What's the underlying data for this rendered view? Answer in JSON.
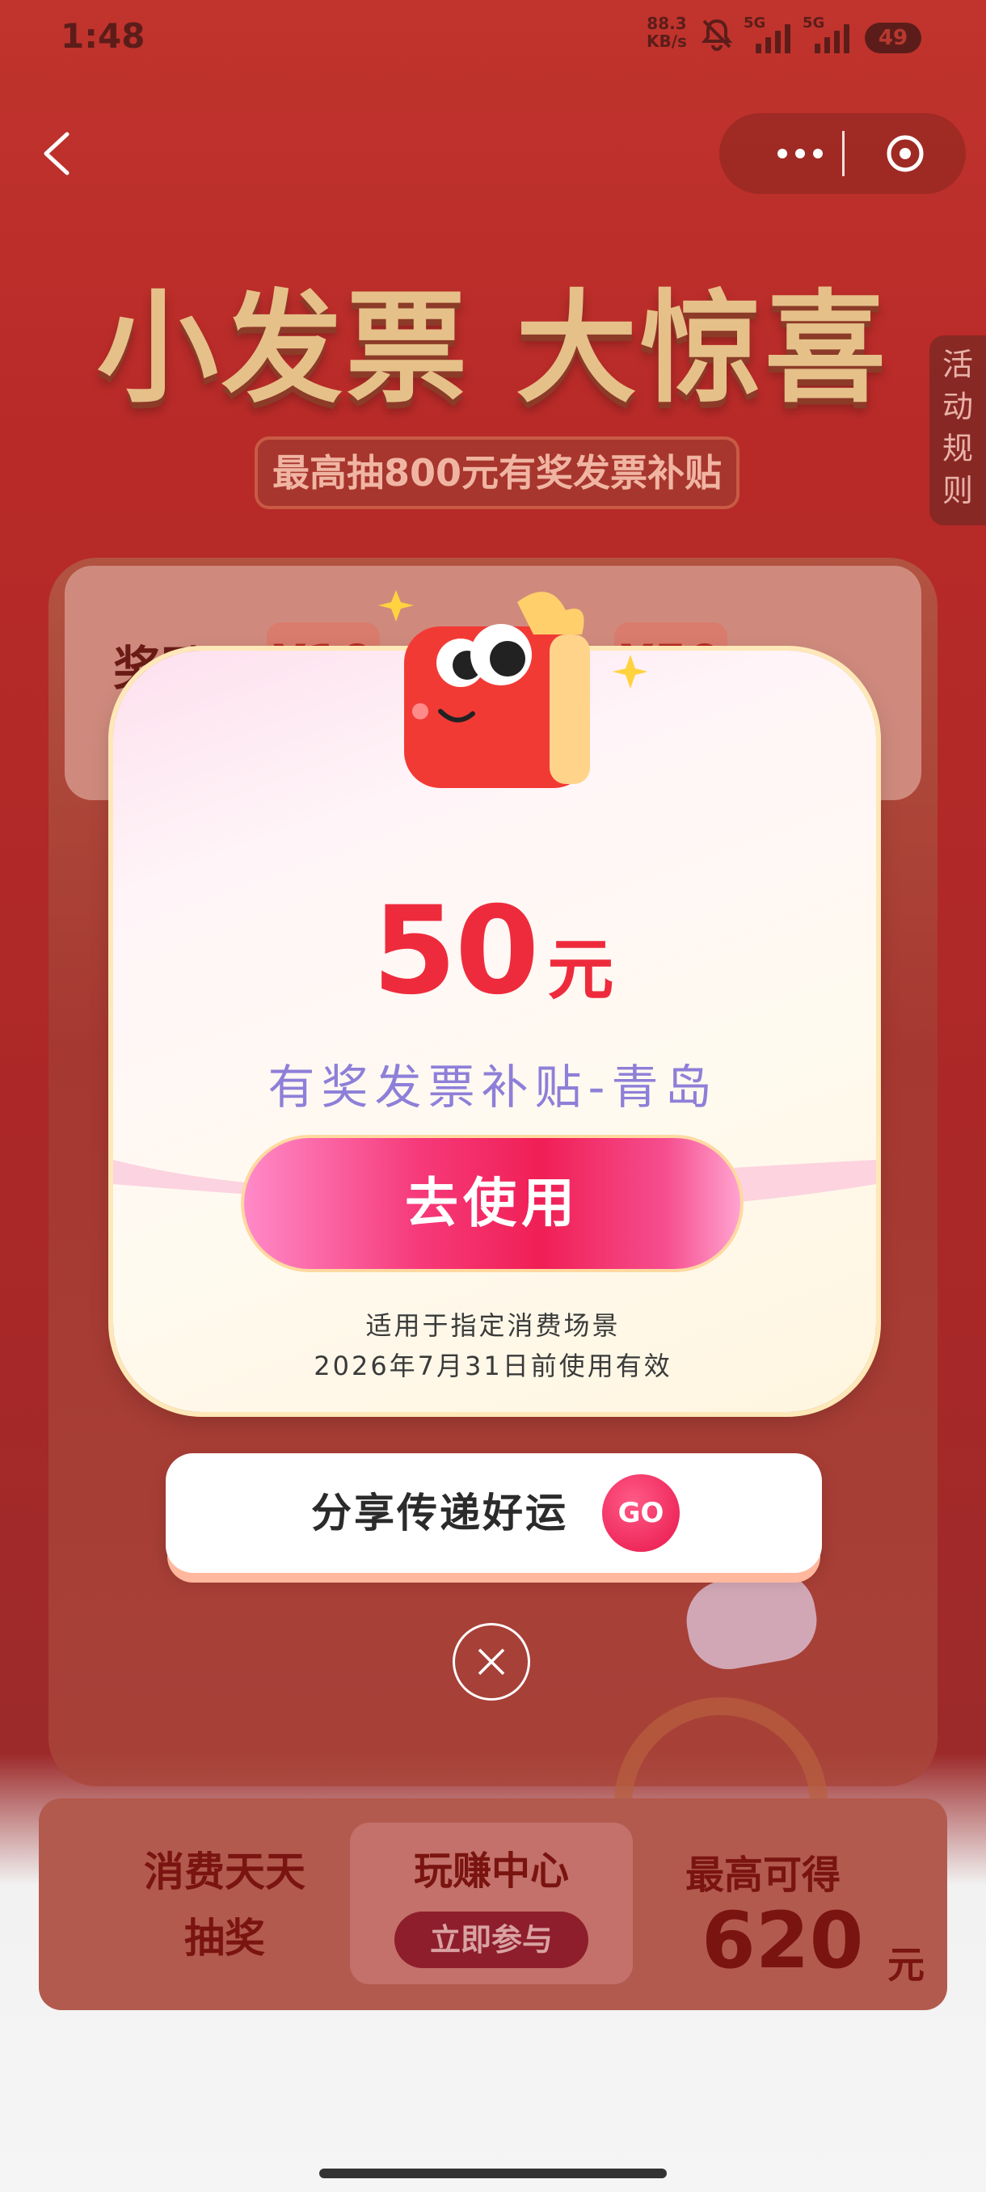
{
  "status_bar": {
    "time": "1:48",
    "net_speed": "88.3",
    "net_unit": "KB/s",
    "sim1": "5G",
    "sim2": "5G",
    "battery": "49"
  },
  "background": {
    "title": "小发票 大惊喜",
    "subtitle": "最高抽800元有奖发票补贴",
    "prize_label": "奖励",
    "chip_left": "¥10",
    "chip_right": "¥50",
    "side_rules": "活动规则"
  },
  "modal": {
    "amount": "50",
    "unit": "元",
    "coupon_name": "有奖发票补贴-青岛",
    "use_button": "去使用",
    "note_line1": "适用于指定消费场景",
    "note_line2": "2026年7月31日前使用有效"
  },
  "share": {
    "label": "分享传递好运",
    "go": "GO"
  },
  "bottom_bar": {
    "left_line1": "消费天天",
    "left_line2": "抽奖",
    "center_title": "玩赚中心",
    "center_button": "立即参与",
    "right_label": "最高可得",
    "right_amount": "620",
    "right_unit": "元"
  },
  "colors": {
    "primary_red": "#ee2b3c",
    "coupon_purple": "#8e7fd8",
    "button_pink": "#f01f55"
  }
}
